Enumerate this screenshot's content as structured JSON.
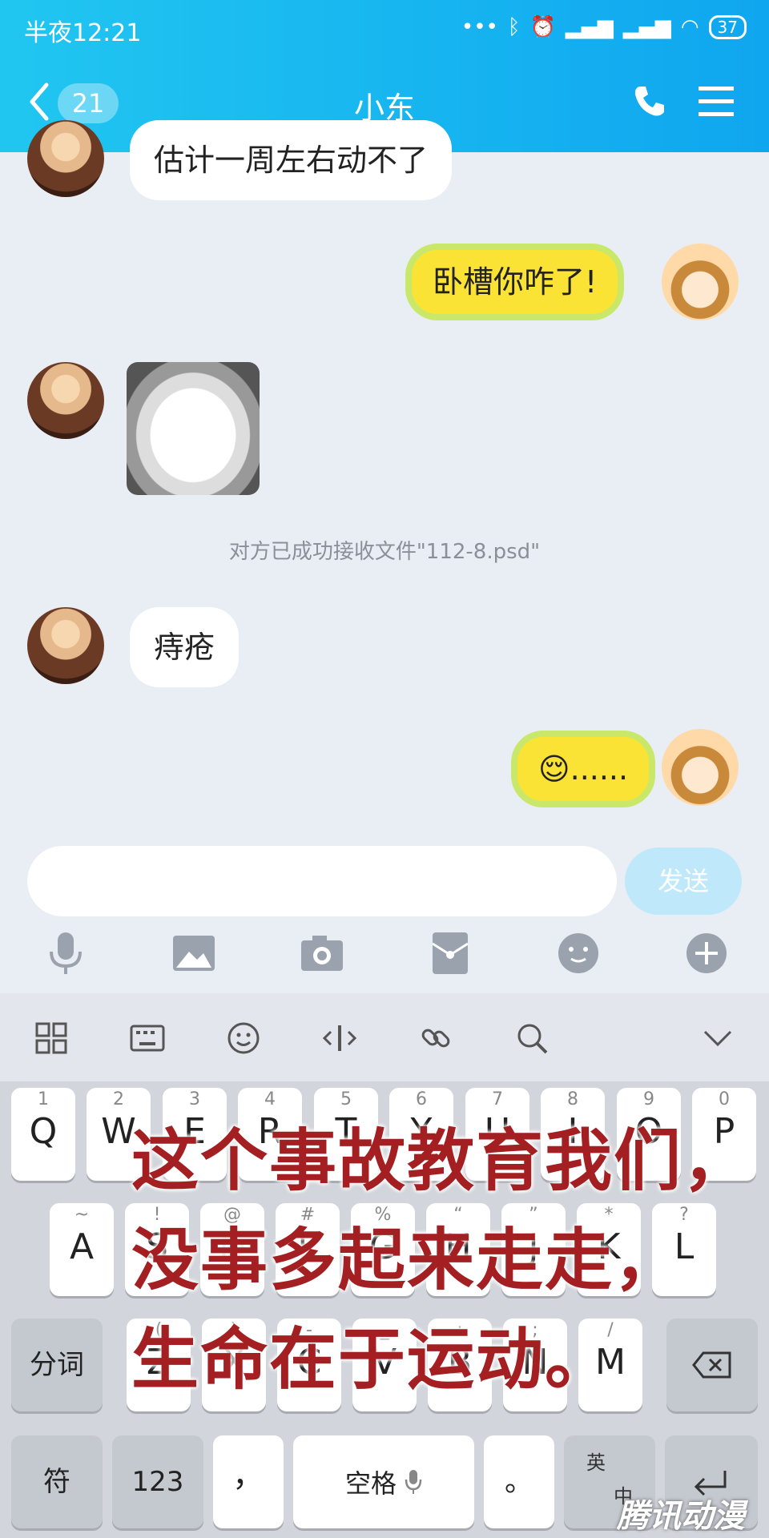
{
  "status": {
    "time": "半夜12:21",
    "battery": "37"
  },
  "header": {
    "unread_count": "21",
    "title": "小东"
  },
  "messages": [
    {
      "text": "估计一周左右动不了"
    },
    {
      "text": "卧槽你咋了!"
    },
    {
      "text": "痔疮"
    },
    {
      "text": "😌......"
    }
  ],
  "system_note": "对方已成功接收文件\"112-8.psd\"",
  "composer": {
    "send_label": "发送"
  },
  "keyboard": {
    "row1": [
      {
        "n": "1",
        "c": "Q"
      },
      {
        "n": "2",
        "c": "W"
      },
      {
        "n": "3",
        "c": "E"
      },
      {
        "n": "4",
        "c": "R"
      },
      {
        "n": "5",
        "c": "T"
      },
      {
        "n": "6",
        "c": "Y"
      },
      {
        "n": "7",
        "c": "U"
      },
      {
        "n": "8",
        "c": "I"
      },
      {
        "n": "9",
        "c": "O"
      },
      {
        "n": "0",
        "c": "P"
      }
    ],
    "row2": [
      {
        "n": "~",
        "c": "A"
      },
      {
        "n": "!",
        "c": "S"
      },
      {
        "n": "@",
        "c": "D"
      },
      {
        "n": "#",
        "c": "F"
      },
      {
        "n": "%",
        "c": "G"
      },
      {
        "n": "“",
        "c": "H"
      },
      {
        "n": "”",
        "c": "J"
      },
      {
        "n": "*",
        "c": "K"
      },
      {
        "n": "?",
        "c": "L"
      }
    ],
    "row3_left": "分词",
    "row3": [
      {
        "n": "(",
        "c": "Z"
      },
      {
        "n": ")",
        "c": "X"
      },
      {
        "n": "-",
        "c": "C"
      },
      {
        "n": "_",
        "c": "V"
      },
      {
        "n": ":",
        "c": "B"
      },
      {
        "n": ";",
        "c": "N"
      },
      {
        "n": "/",
        "c": "M"
      }
    ],
    "bottom": {
      "sym": "符",
      "num": "123",
      "comma": "，",
      "space": "空格",
      "period": "。",
      "lang_top": "英",
      "lang_bottom": "中"
    }
  },
  "caption": [
    "这个事故教育我们，",
    "没事多起来走走，",
    "生命在于运动。"
  ],
  "watermark": "腾讯动漫"
}
